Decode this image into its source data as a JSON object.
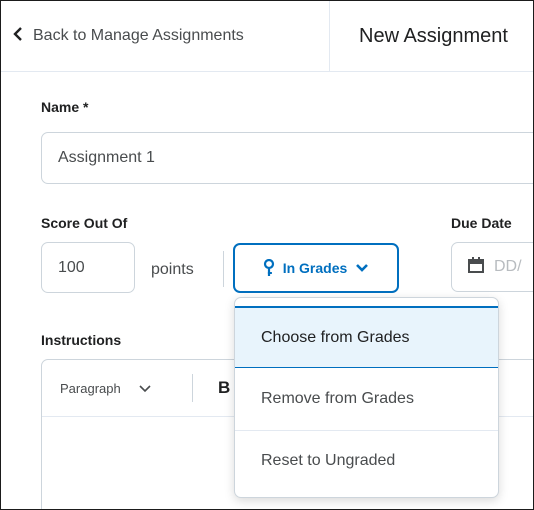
{
  "nav": {
    "back_label": "Back to Manage Assignments",
    "page_title": "New Assignment"
  },
  "form": {
    "name_label": "Name *",
    "name_value": "Assignment 1",
    "score_label": "Score Out Of",
    "score_value": "100",
    "points_label": "points",
    "grades_button_label": "In Grades",
    "due_date_label": "Due Date",
    "due_date_placeholder": "DD/",
    "instructions_label": "Instructions"
  },
  "editor": {
    "format_value": "Paragraph",
    "bold_label": "B"
  },
  "grades_menu": {
    "items": [
      {
        "label": "Choose from Grades",
        "selected": true
      },
      {
        "label": "Remove from Grades",
        "selected": false
      },
      {
        "label": "Reset to Ungraded",
        "selected": false
      }
    ]
  },
  "colors": {
    "accent": "#006fbf",
    "selected_bg": "#e8f4fc",
    "border": "#cdd5dc",
    "text_primary": "#202122",
    "text_secondary": "#494c4e",
    "placeholder": "#b8bcc0"
  },
  "icons": {
    "back": "chevron-left-icon",
    "grades": "pin-icon",
    "grades_toggle": "chevron-down-icon",
    "calendar": "calendar-icon",
    "format_toggle": "chevron-down-icon"
  }
}
